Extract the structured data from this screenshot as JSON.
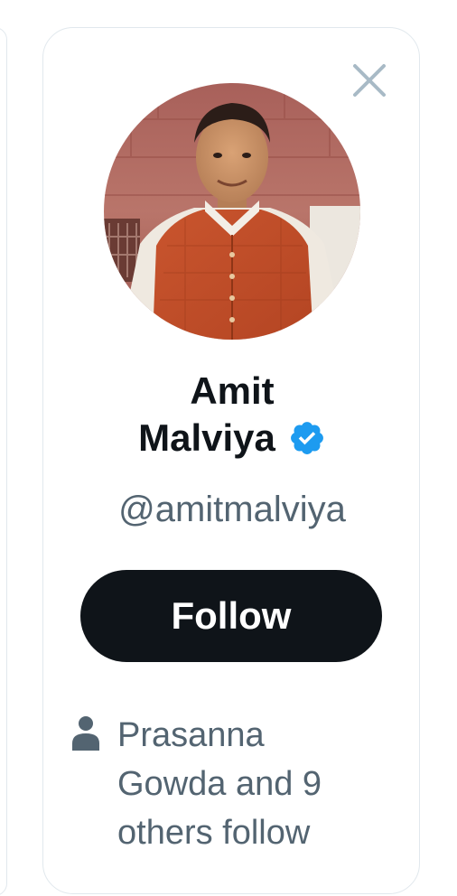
{
  "card": {
    "name_line1": "Amit",
    "name_line2": "Malviya",
    "handle": "@amitmalviya",
    "follow_label": "Follow",
    "social_context": "Prasanna Gowda and 9 others follow",
    "close_icon": "close-icon",
    "verified_icon": "verified-badge-icon",
    "person_icon": "person-icon",
    "avatar": "profile-photo"
  },
  "colors": {
    "text_primary": "#0f1419",
    "text_secondary": "#536471",
    "verified_blue": "#1d9bf0",
    "button_bg": "#0f1419",
    "button_text": "#ffffff",
    "close_icon": "#a8bac6"
  }
}
